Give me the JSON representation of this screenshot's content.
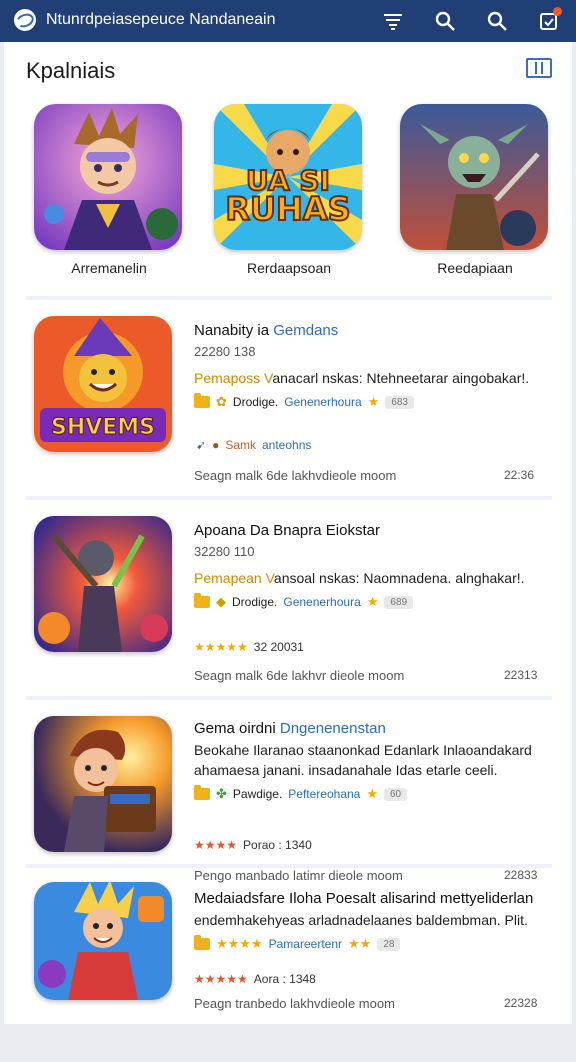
{
  "header": {
    "title": "Ntunrdpeiasepeuce Nandaneain",
    "icons": [
      "logo-icon",
      "filter-icon",
      "search-icon",
      "search-icon",
      "notification-icon"
    ]
  },
  "page": {
    "title": "Kpalniais"
  },
  "featured": [
    {
      "label": "Arremanelin",
      "icon": "hero-mage-art"
    },
    {
      "label": "Rerdaapsoan",
      "icon": "game-logo-art",
      "art_text_1": "UA   SI",
      "art_text_2": "RUHAS"
    },
    {
      "label": "Reedapiaan",
      "icon": "goblin-warrior-art"
    }
  ],
  "apps": [
    {
      "name_a": "Nanabity ia ",
      "name_b": "Gemdans",
      "sub": "22280 138",
      "desc_hl": "Pemaposs V",
      "desc_rest": "anacarl nskas: Ntehneetarar aingobakar!.",
      "meta_mid": "Drodige.",
      "meta_link": "Genenerhoura",
      "badge": "683",
      "tag_key": "Samk",
      "tag_val": "anteohns",
      "footer": "Seagn malk 6de   lakhvdieole  moom",
      "time": "22:36",
      "art_text": "SHVEMS"
    },
    {
      "name_a": "Apoana Da Bnapra Eiokstar",
      "name_b": "",
      "sub": "32280 110",
      "desc_hl": "Pemapean V",
      "desc_rest": "ansoal nskas: Naomnadena. alnghakar!.",
      "meta_mid": "Drodige.",
      "meta_link": "Genenerhoura",
      "badge": "689",
      "rating_stars": "★★★★★",
      "rating_text": "32 20031",
      "footer": "Seagn malk 6de   lakhvr dieole  moom",
      "time": "22313"
    },
    {
      "name_a": "Gema oirdni ",
      "name_b": "Dngenenenstan",
      "desc_line1": "Beokahe Ilaranao staanonkad Edanlark Inlaoandakard",
      "desc_line2": "ahamaesa janani. insadanahale Idas etarle ceeli.",
      "meta_mid": "Pawdige.",
      "meta_link": "Peftereohana",
      "badge": "60",
      "rating_stars": "★★★★",
      "rating_text": "Porao : 1340",
      "footer": "Pengo manbado  latimr dieole  moom",
      "time": "22833"
    },
    {
      "name_a": "Medaiadsfare Iloha Poesalt alisarind mettyeliderlan",
      "desc_line2": "endemhakehyeas arladnadelaanes baldembman. Plit.",
      "meta_stars": "★★★★",
      "meta_link": "Pamareertenr",
      "badge": "28",
      "rating_stars": "★★★★★",
      "rating_text": "Aora : 1348",
      "footer": "Peagn tranbedo  lakhvdieole  moom",
      "time": "22328"
    }
  ],
  "colors": {
    "header_bg": "#1f3f75",
    "accent": "#2d6bb8",
    "star": "#f2a900",
    "highlight": "#c98b00"
  }
}
